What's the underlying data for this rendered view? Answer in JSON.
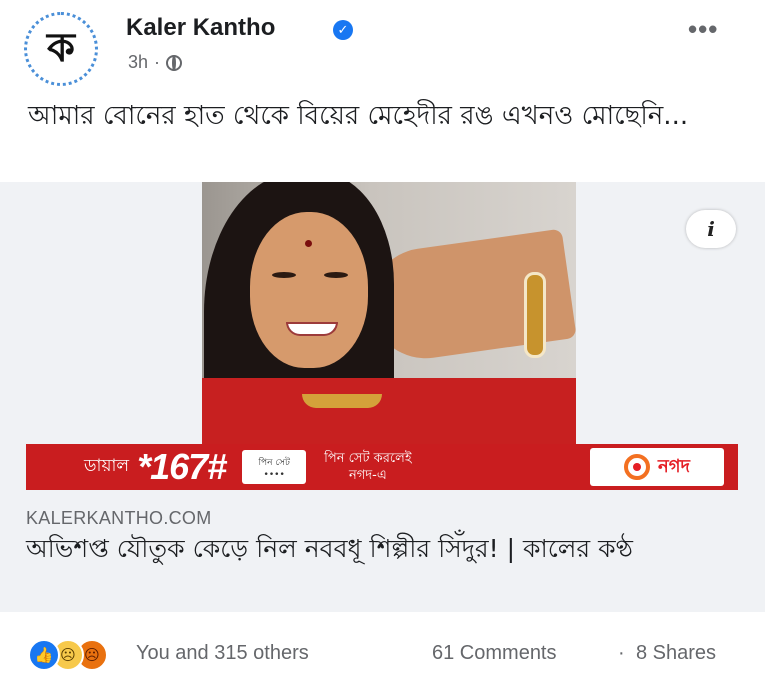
{
  "post": {
    "page_name": "Kaler Kantho",
    "avatar_letter": "ক",
    "verified": "✓",
    "time": "3h",
    "dot": "·",
    "more": "•••",
    "caption": "আমার বোনের হাত থেকে বিয়ের মেহেদীর রঙ এখনও মোছেনি..."
  },
  "link_preview": {
    "info_icon": "i",
    "ad": {
      "dial": "ডায়াল",
      "code": "*167#",
      "phone_line1": "পিন সেট",
      "phone_line2": "••••",
      "pin_line1": "পিন সেট করলেই",
      "pin_line2": "নগদ-এ",
      "brand": "নগদ",
      "brand_color": "#e51e25"
    },
    "domain": "KALERKANTHO.COM",
    "title": "অভিশপ্ত যৌতুক কেড়ে নিল নববধূ শিল্পীর সিঁদুর! | কালের কণ্ঠ"
  },
  "footer": {
    "reaction_icons": [
      "like-icon",
      "sad-icon",
      "angry-icon"
    ],
    "reactions_text": "You and 315 others",
    "comments": "61 Comments",
    "separator": "·",
    "shares": "8 Shares"
  }
}
